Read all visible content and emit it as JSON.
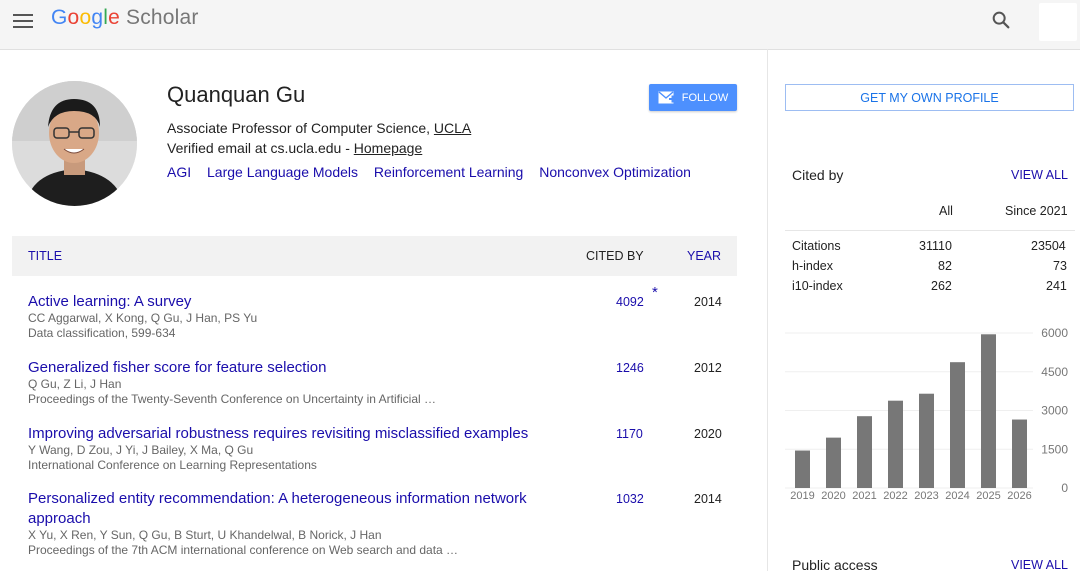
{
  "header": {
    "logo_letters": [
      "G",
      "o",
      "o",
      "g",
      "l",
      "e"
    ],
    "logo_suffix": "Scholar",
    "icons": [
      "menu-icon",
      "search-icon"
    ]
  },
  "profile": {
    "name": "Quanquan Gu",
    "affiliation_prefix": "Associate Professor of Computer Science, ",
    "affiliation_link": "UCLA",
    "email_prefix": "Verified email at cs.ucla.edu - ",
    "homepage_link": "Homepage",
    "interests": [
      "AGI",
      "Large Language Models",
      "Reinforcement Learning",
      "Nonconvex Optimization"
    ],
    "follow_label": "FOLLOW",
    "get_profile_label": "GET MY OWN PROFILE"
  },
  "table": {
    "col_title": "TITLE",
    "col_cited": "CITED BY",
    "col_year": "YEAR",
    "rows": [
      {
        "title": "Active learning: A survey",
        "authors": "CC Aggarwal, X Kong, Q Gu, J Han, PS Yu",
        "venue": "Data classification, 599-634",
        "cited": "4092",
        "star": "*",
        "year": "2014"
      },
      {
        "title": "Generalized fisher score for feature selection",
        "authors": "Q Gu, Z Li, J Han",
        "venue": "Proceedings of the Twenty-Seventh Conference on Uncertainty in Artificial …",
        "cited": "1246",
        "star": "",
        "year": "2012"
      },
      {
        "title": "Improving adversarial robustness requires revisiting misclassified examples",
        "authors": "Y Wang, D Zou, J Yi, J Bailey, X Ma, Q Gu",
        "venue": "International Conference on Learning Representations",
        "cited": "1170",
        "star": "",
        "year": "2020"
      },
      {
        "title": "Personalized entity recommendation: A heterogeneous information network approach",
        "authors": "X Yu, X Ren, Y Sun, Q Gu, B Sturt, U Khandelwal, B Norick, J Han",
        "venue": "Proceedings of the 7th ACM international conference on Web search and data …",
        "cited": "1032",
        "star": "",
        "year": "2014"
      }
    ]
  },
  "sidebar": {
    "cited_by_label": "Cited by",
    "view_all_label": "VIEW ALL",
    "col_all": "All",
    "col_since": "Since 2021",
    "stats": [
      {
        "label": "Citations",
        "all": "31110",
        "since": "23504"
      },
      {
        "label": "h-index",
        "all": "82",
        "since": "73"
      },
      {
        "label": "i10-index",
        "all": "262",
        "since": "241"
      }
    ],
    "public_access_label": "Public access",
    "public_view_all_label": "VIEW ALL"
  },
  "chart_data": {
    "type": "bar",
    "categories": [
      "2019",
      "2020",
      "2021",
      "2022",
      "2023",
      "2024",
      "2025",
      "2026"
    ],
    "values": [
      1450,
      1950,
      2780,
      3380,
      3650,
      4870,
      5950,
      2650
    ],
    "yticks": [
      "6000",
      "4500",
      "3000",
      "1500",
      "0"
    ],
    "ylim": [
      0,
      6000
    ],
    "bar_color": "#777777"
  }
}
